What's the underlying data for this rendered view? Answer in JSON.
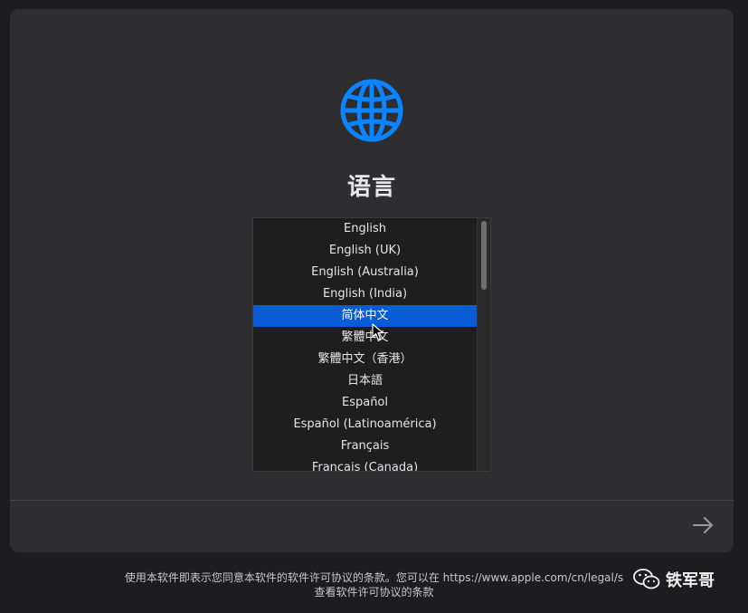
{
  "window": {
    "title": "语言",
    "languages": [
      "English",
      "English (UK)",
      "English (Australia)",
      "English (India)",
      "简体中文",
      "繁體中文",
      "繁體中文（香港）",
      "日本語",
      "Español",
      "Español (Latinoamérica)",
      "Français",
      "Français (Canada)"
    ],
    "selected_index": 4,
    "next_icon": "arrow-right-icon",
    "globe_icon": "globe-icon",
    "accent_color": "#0a84ff",
    "selection_color": "#0a5bd6"
  },
  "footer": {
    "line1": "使用本软件即表示您同意本软件的软件许可协议的条款。您可以在 https://www.apple.com/cn/legal/s",
    "line2": "查看软件许可协议的条款"
  },
  "watermark": {
    "icon": "wechat-icon",
    "text": "铁军哥"
  }
}
